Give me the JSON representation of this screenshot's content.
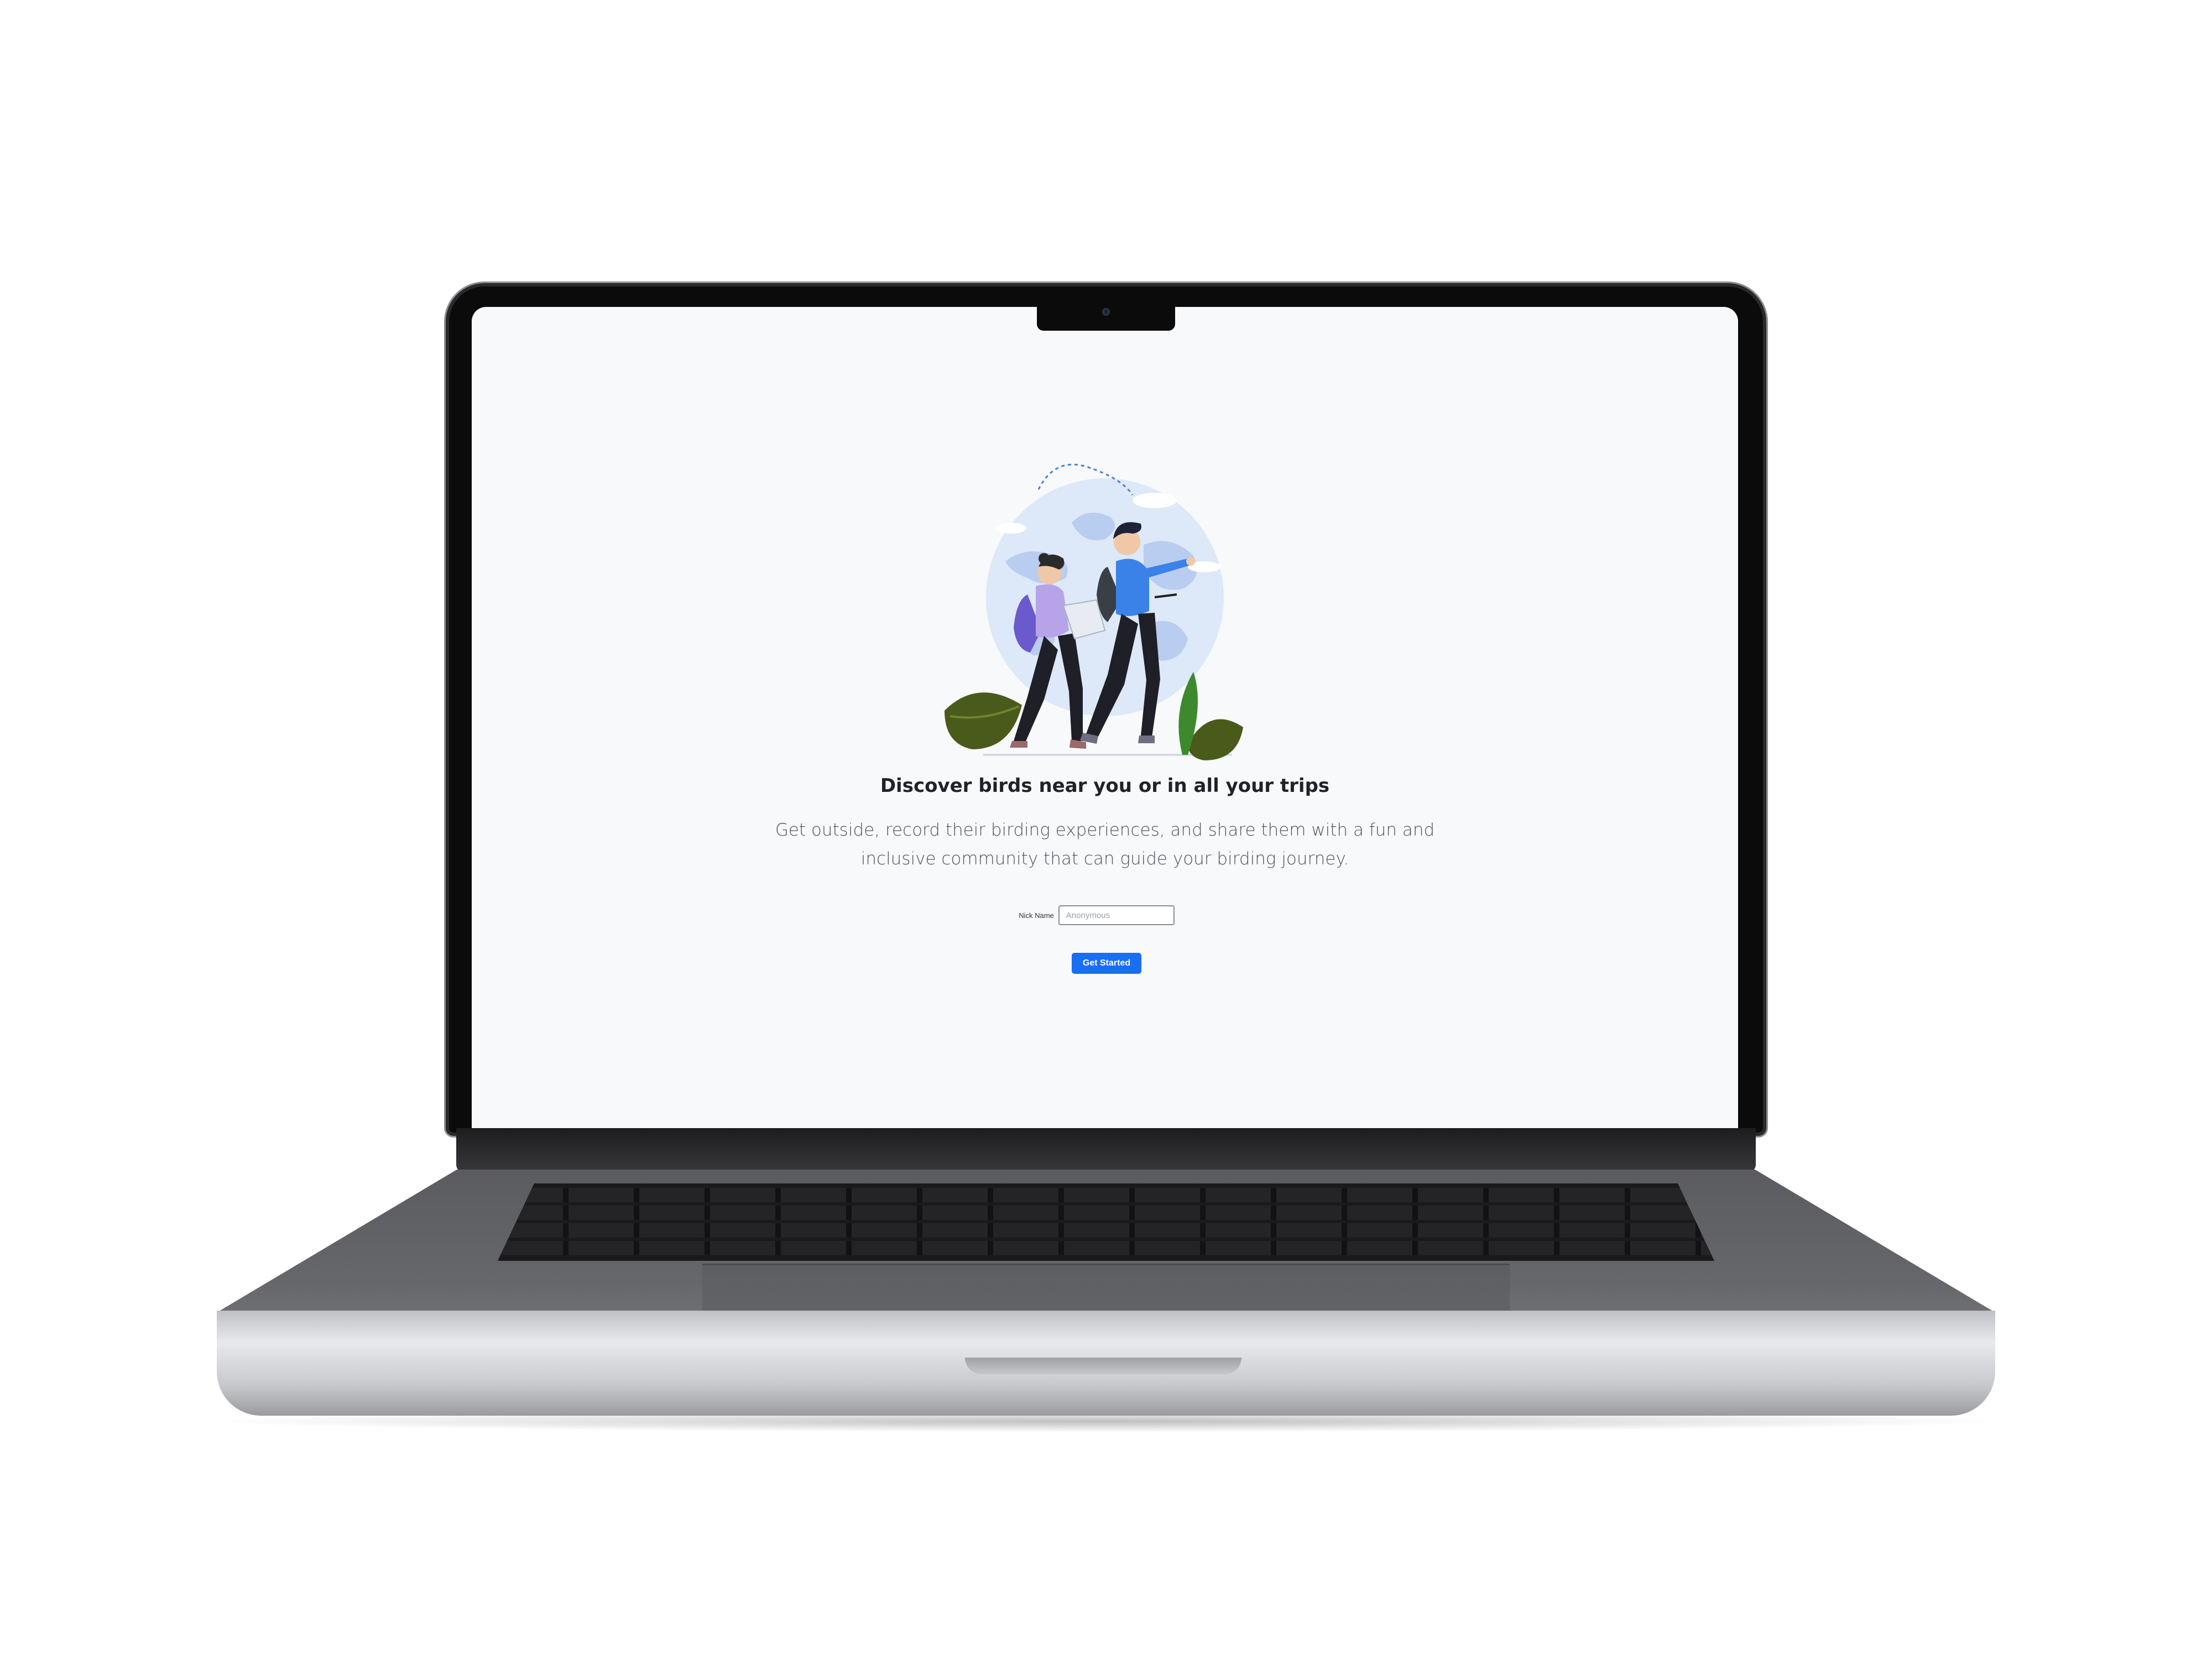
{
  "page": {
    "heading": "Discover birds near you or in all your trips",
    "description": "Get outside, record their birding experiences, and share them with a fun and inclusive community that can guide your birding journey."
  },
  "form": {
    "nickname_label": "Nick Name",
    "nickname_placeholder": "Anonymous",
    "submit_label": "Get Started"
  },
  "illustration": {
    "icon": "hikers-globe-illustration"
  },
  "colors": {
    "primary_button": "#1a6ff0",
    "page_background": "#f8f9fa",
    "heading_text": "#1f2329",
    "body_text": "#4f565e"
  }
}
